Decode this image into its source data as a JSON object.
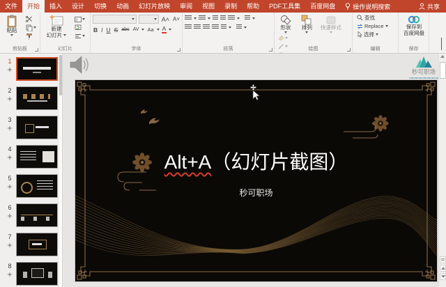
{
  "tabbar": {
    "tabs": [
      {
        "label": "文件"
      },
      {
        "label": "开始"
      },
      {
        "label": "插入"
      },
      {
        "label": "设计"
      },
      {
        "label": "切换"
      },
      {
        "label": "动画"
      },
      {
        "label": "幻灯片放映"
      },
      {
        "label": "审阅"
      },
      {
        "label": "视图"
      },
      {
        "label": "录制"
      },
      {
        "label": "帮助"
      },
      {
        "label": "PDF工具集"
      },
      {
        "label": "百度网盘"
      }
    ],
    "tellme_label": "操作说明搜索",
    "share_label": "共享"
  },
  "ribbon": {
    "clipboard": {
      "paste_label": "粘贴",
      "group_label": "剪贴板"
    },
    "slides": {
      "new_slide_line1": "新建",
      "new_slide_line2": "幻灯片",
      "group_label": "幻灯片"
    },
    "font": {
      "bold": "B",
      "italic": "I",
      "underline": "U",
      "strikethrough": "S",
      "clear_abc": "abc",
      "char_spacing": "AV",
      "change_case": "Aa",
      "font_color": "A",
      "group_label": "字体"
    },
    "paragraph": {
      "group_label": "段落"
    },
    "drawing": {
      "shapes_label": "形状",
      "arrange_label": "排列",
      "quick_styles_label": "快速样式",
      "group_label": "绘图"
    },
    "editing": {
      "find_label": "查找",
      "replace_label": "Replace",
      "select_label": "选择",
      "group_label": "编辑"
    },
    "save": {
      "line1": "保存到",
      "line2": "百度网盘",
      "group_label": "保存"
    }
  },
  "thumbnails": [
    {
      "number": "1"
    },
    {
      "number": "2"
    },
    {
      "number": "3"
    },
    {
      "number": "4"
    },
    {
      "number": "5"
    },
    {
      "number": "6"
    },
    {
      "number": "7"
    },
    {
      "number": "8"
    }
  ],
  "slide": {
    "title_latin": "Alt+A",
    "title_cjk": "（幻灯片截图）",
    "subtitle": "秒可职场"
  },
  "logo": {
    "name": "秒可职场"
  },
  "colors": {
    "accent_red": "#C0452B",
    "selection_orange": "#CF4C26",
    "slide_gold": "#8A6A45",
    "slide_bg": "#0B0906",
    "logo_teal": "#35AFA5"
  }
}
